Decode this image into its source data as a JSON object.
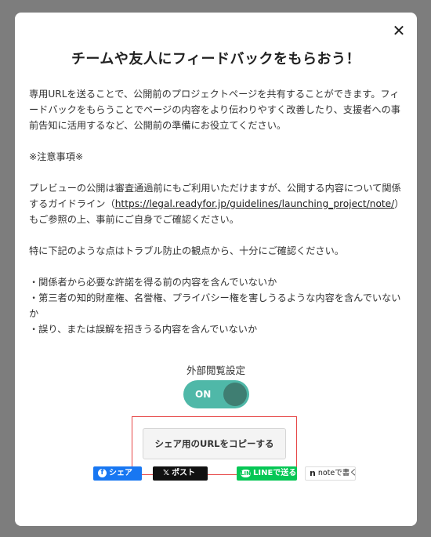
{
  "modal": {
    "close_glyph": "✕",
    "title": "チームや友人にフィードバックをもらおう！",
    "intro": "専用URLを送ることで、公開前のプロジェクトページを共有することができます。フィードバックをもらうことでページの内容をより伝わりやすく改善したり、支援者への事前告知に活用するなど、公開前の準備にお役立てください。",
    "notice_heading": "※注意事項※",
    "preview_text_before": "プレビューの公開は審査通過前にもご利用いただけますが、公開する内容について関係するガイドライン（",
    "guideline_link": "https://legal.readyfor.jp/guidelines/launching_project/note/",
    "preview_text_after": "）もご参照の上、事前にご自身でご確認ください。",
    "check_intro": "特に下記のような点はトラブル防止の観点から、十分にご確認ください。",
    "check_items": [
      "・関係者から必要な許諾を得る前の内容を含んでいないか",
      "・第三者の知的財産権、名誉権、プライバシー権を害しうるような内容を含んでいないか",
      "・誤り、または誤解を招きうる内容を含んでいないか"
    ],
    "toggle_label": "外部閲覧設定",
    "toggle_state": "ON",
    "copy_button": "シェア用のURLをコピーする",
    "share": {
      "facebook": {
        "icon": "f",
        "label": "シェア"
      },
      "x": {
        "icon": "𝕏",
        "label": "ポスト"
      },
      "line": {
        "icon": "LINE",
        "label": "LINEで送る"
      },
      "note": {
        "icon": "n",
        "label": "noteで書く"
      }
    }
  },
  "colors": {
    "toggle_bg": "#4fb8a8",
    "highlight_border": "#e64545",
    "facebook": "#1877f2",
    "line": "#06c755"
  }
}
